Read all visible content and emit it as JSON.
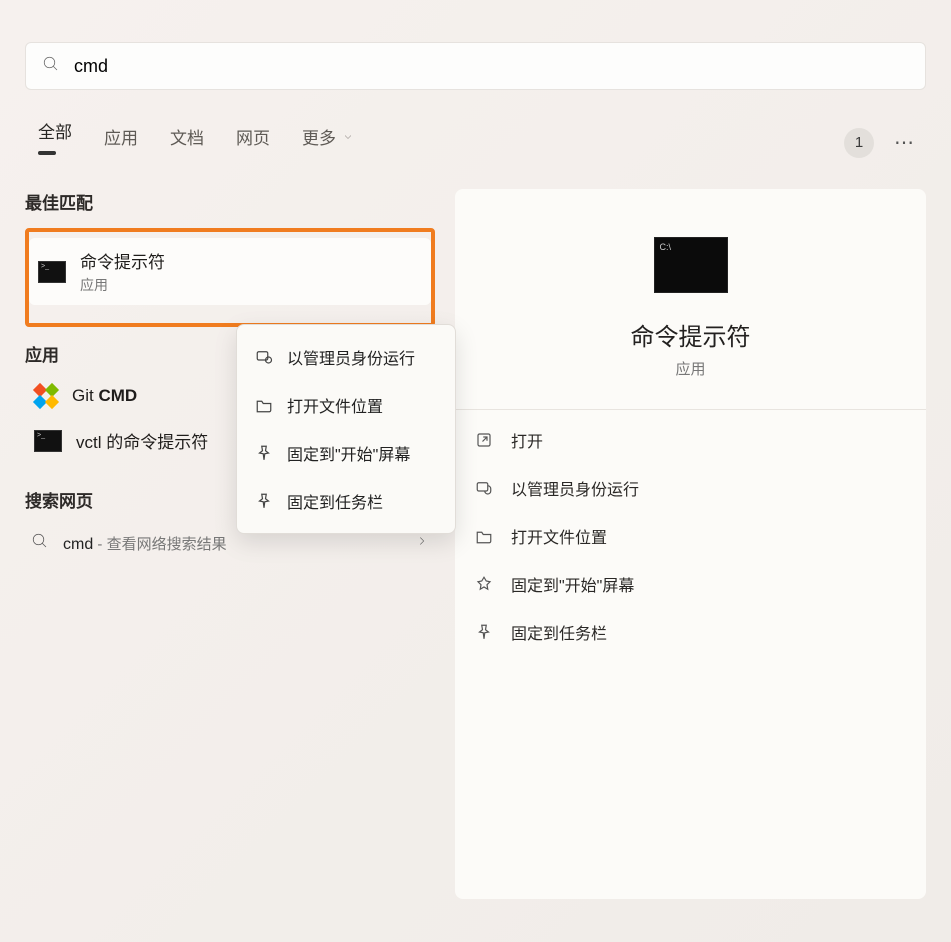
{
  "search": {
    "value": "cmd"
  },
  "tabs": {
    "all": "全部",
    "apps": "应用",
    "docs": "文档",
    "web": "网页",
    "more": "更多"
  },
  "badge": "1",
  "sections": {
    "best_match": "最佳匹配",
    "apps": "应用",
    "web": "搜索网页"
  },
  "best_match": {
    "title": "命令提示符",
    "subtitle": "应用"
  },
  "app_results": {
    "git_cmd_prefix": "Git ",
    "git_cmd_bold": "CMD",
    "vctl": "vctl 的命令提示符"
  },
  "web_result": {
    "term": "cmd",
    "sep": " - ",
    "desc": "查看网络搜索结果"
  },
  "context_menu": {
    "run_admin": "以管理员身份运行",
    "open_location": "打开文件位置",
    "pin_start": "固定到\"开始\"屏幕",
    "pin_taskbar": "固定到任务栏"
  },
  "detail": {
    "title": "命令提示符",
    "subtitle": "应用",
    "actions": {
      "open": "打开",
      "run_admin": "以管理员身份运行",
      "open_location": "打开文件位置",
      "pin_start": "固定到\"开始\"屏幕",
      "pin_taskbar": "固定到任务栏"
    }
  }
}
